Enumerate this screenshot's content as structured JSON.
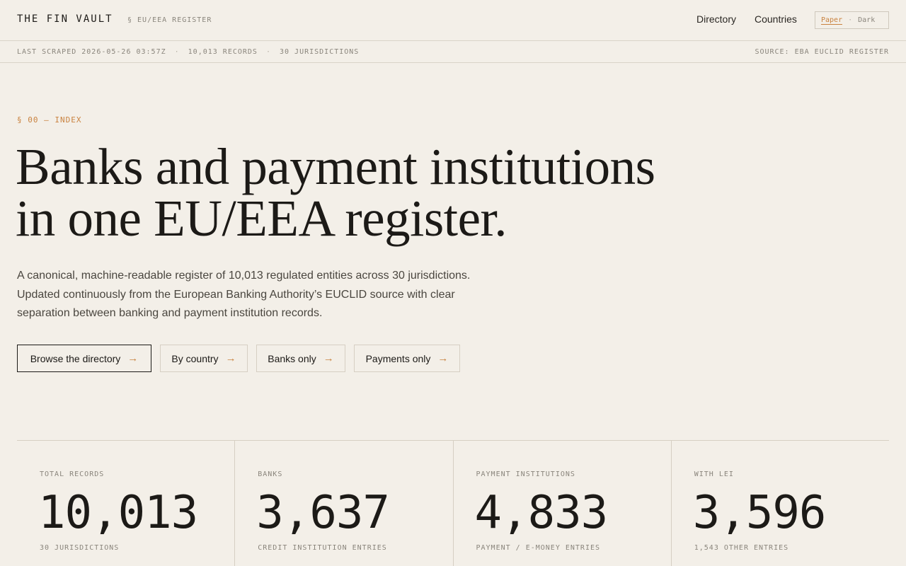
{
  "header": {
    "brand": "THE FIN VAULT",
    "brand_sub": "§ EU/EEA REGISTER",
    "nav": {
      "directory": "Directory",
      "countries": "Countries"
    },
    "theme": {
      "paper": "Paper",
      "separator": "·",
      "dark": "Dark",
      "active": "Paper"
    }
  },
  "status": {
    "scraped": "LAST SCRAPED 2026-05-26 03:57Z",
    "records": "10,013 RECORDS",
    "jurisdictions": "30 JURISDICTIONS",
    "separator": "·",
    "source": "SOURCE: EBA EUCLID REGISTER"
  },
  "hero": {
    "tag": "§ 00 — INDEX",
    "headline_line1": "Banks and payment institutions",
    "headline_line2": "in one EU/EEA register.",
    "lede": "A canonical, machine-readable register of 10,013 regulated entities across 30 jurisdictions. Updated continuously from the European Banking Authority’s EUCLID source with clear separation between banking and payment institution records."
  },
  "actions": {
    "browse": "Browse the directory",
    "country": "By country",
    "banks": "Banks only",
    "payments": "Payments only",
    "arrow": "→"
  },
  "stats": [
    {
      "label": "TOTAL RECORDS",
      "value": "10,013",
      "sub": "30 JURISDICTIONS"
    },
    {
      "label": "BANKS",
      "value": "3,637",
      "sub": "CREDIT INSTITUTION ENTRIES"
    },
    {
      "label": "PAYMENT INSTITUTIONS",
      "value": "4,833",
      "sub": "PAYMENT / E-MONEY ENTRIES"
    },
    {
      "label": "WITH LEI",
      "value": "3,596",
      "sub": "1,543 OTHER ENTRIES"
    }
  ],
  "colors": {
    "background": "#f3efe8",
    "accent": "#c9823f",
    "ink": "#1c1a17",
    "muted": "#8a857c"
  }
}
